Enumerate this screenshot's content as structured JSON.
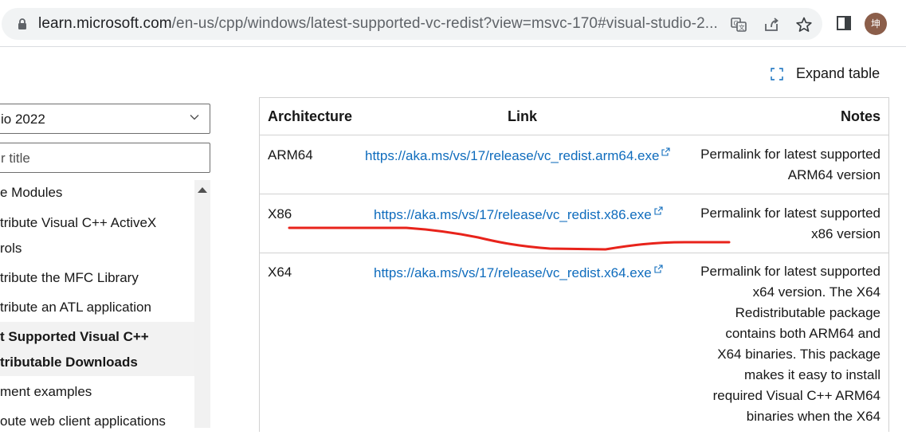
{
  "browser": {
    "url_domain": "learn.microsoft.com",
    "url_path": "/en-us/cpp/windows/latest-supported-vc-redist?view=msvc-170#visual-studio-2...",
    "avatar_text": "坤",
    "icons": [
      "lock-icon",
      "translate-icon",
      "share-icon",
      "star-icon",
      "side-panel-icon"
    ]
  },
  "nav": {
    "version_select": "io 2022",
    "filter_placeholder": "r title",
    "items": [
      {
        "label": "e Modules"
      },
      {
        "label": "tribute Visual C++ ActiveX"
      },
      {
        "label": "rols"
      },
      {
        "label": "tribute the MFC Library"
      },
      {
        "label": "tribute an ATL application"
      },
      {
        "label": "t Supported Visual C++"
      },
      {
        "label": "tributable Downloads"
      },
      {
        "label": "ment examples"
      },
      {
        "label": "oute web client applications"
      }
    ]
  },
  "expand_table": {
    "label": "Expand table",
    "icon": "expand-icon"
  },
  "table": {
    "headers": {
      "architecture": "Architecture",
      "link": "Link",
      "notes": "Notes"
    },
    "rows": [
      {
        "architecture": "ARM64",
        "link": "https://aka.ms/vs/17/release/vc_redist.arm64.exe",
        "notes_lines": [
          "Permalink for latest supported",
          "ARM64 version"
        ]
      },
      {
        "architecture": "X86",
        "link": "https://aka.ms/vs/17/release/vc_redist.x86.exe",
        "notes_lines": [
          "Permalink for latest supported",
          "x86 version"
        ]
      },
      {
        "architecture": "X64",
        "link": "https://aka.ms/vs/17/release/vc_redist.x64.exe",
        "notes_lines": [
          "Permalink for latest supported",
          "x64 version. The X64",
          "Redistributable package",
          "contains both ARM64 and",
          "X64 binaries. This package",
          "makes it easy to install",
          "required Visual C++ ARM64",
          "binaries when the X64"
        ]
      }
    ]
  },
  "annotation": {
    "color": "#e8231b"
  }
}
